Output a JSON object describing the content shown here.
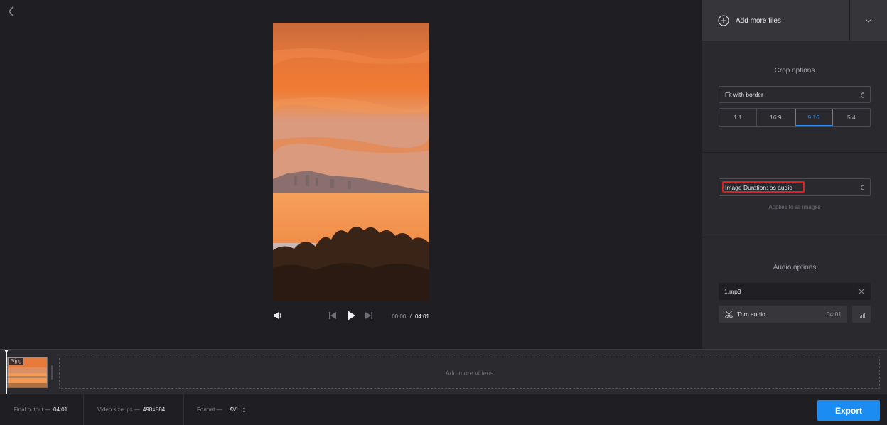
{
  "header": {
    "back_icon": "chevron-left-icon"
  },
  "player": {
    "current_time": "00:00",
    "separator": "/",
    "total_time": "04:01",
    "icons": [
      "volume-icon",
      "previous-icon",
      "play-icon",
      "next-icon"
    ]
  },
  "sidebar": {
    "add_files_label": "Add more files",
    "crop": {
      "title": "Crop options",
      "fit_mode": "Fit with border",
      "ratios": [
        "1:1",
        "16:9",
        "9:16",
        "5:4"
      ],
      "active_ratio": "9:16"
    },
    "duration": {
      "value": "Image Duration: as audio",
      "hint": "Applies to all images"
    },
    "audio": {
      "title": "Audio options",
      "file_name": "1.mp3",
      "trim_label": "Trim audio",
      "trim_duration": "04:01"
    }
  },
  "timeline": {
    "clip_label": "5.jpg",
    "add_more_label": "Add more videos"
  },
  "footer": {
    "final_output_label": "Final output —",
    "final_output_value": "04:01",
    "video_size_label": "Video size, px —",
    "video_size_value": "498×884",
    "format_label": "Format —",
    "format_value": "AVI",
    "export_label": "Export"
  },
  "colors": {
    "accent": "#1a8cf2",
    "active_ratio": "#2f8cf0",
    "highlight_box": "#e02020",
    "sidebar_bg": "#29292e",
    "app_bg": "#1e1e23"
  }
}
